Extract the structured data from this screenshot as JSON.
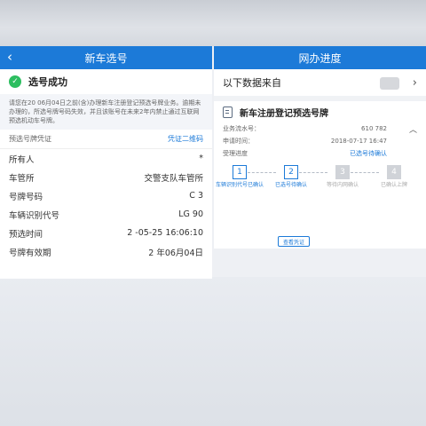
{
  "left": {
    "nav_title": "新车选号",
    "back_icon": "chevron-left-icon",
    "success_text": "选号成功",
    "check_icon": "checkmark-icon",
    "notice": "请您在20 06月04日之前(含)办理新车注册登记预选号牌业务。逾期未办理的，所选号牌号码失效，并且该账号在未来2年内禁止通过互联网预选机动车号牌。",
    "cert_label": "预选号牌凭证",
    "qr_label": "凭证二维码",
    "rows": [
      {
        "label": "所有人",
        "value": "*"
      },
      {
        "label": "车管所",
        "value": "交警支队车管所"
      },
      {
        "label": "号牌号码",
        "value": "C  3"
      },
      {
        "label": "车辆识别代号",
        "value": "LG   90"
      },
      {
        "label": "预选时间",
        "value": "2 -05-25 16:06:10"
      },
      {
        "label": "号牌有效期",
        "value": "2 年06月04日"
      }
    ]
  },
  "right": {
    "nav_title": "网办进度",
    "source_label": "以下数据来自",
    "chevron_icon": "chevron-right-icon",
    "item_title": "新车注册登记预选号牌",
    "doc_icon": "document-icon",
    "details": [
      {
        "label": "业务流水号：",
        "value": "610  782"
      },
      {
        "label": "申请时间：",
        "value": "2018-07-17 16:47"
      },
      {
        "label": "受理进度",
        "value": "已选号待确认"
      }
    ],
    "collapse_icon": "chevron-up-icon",
    "steps": [
      {
        "num": "1",
        "label": "车辆识别代号已确认",
        "active": true
      },
      {
        "num": "2",
        "label": "已选号待确认",
        "active": true
      },
      {
        "num": "3",
        "label": "等待内网确认",
        "active": false
      },
      {
        "num": "4",
        "label": "已确认上牌",
        "active": false
      }
    ],
    "view_button": "查看凭证"
  }
}
